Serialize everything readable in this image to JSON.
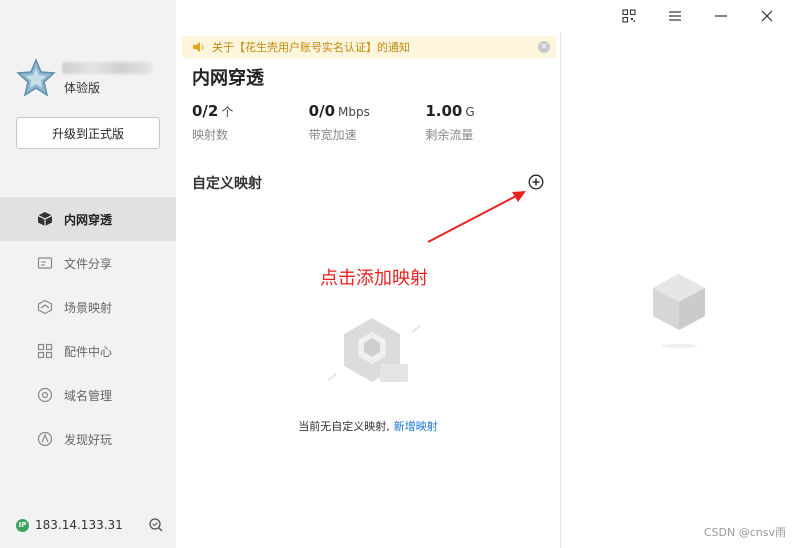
{
  "sidebar": {
    "edition": "体验版",
    "upgrade_label": "升级到正式版",
    "items": [
      {
        "label": "内网穿透",
        "icon": "cube-icon",
        "active": true
      },
      {
        "label": "文件分享",
        "icon": "file-share-icon",
        "active": false
      },
      {
        "label": "场景映射",
        "icon": "scene-map-icon",
        "active": false
      },
      {
        "label": "配件中心",
        "icon": "grid-icon",
        "active": false
      },
      {
        "label": "域名管理",
        "icon": "domain-icon",
        "active": false
      },
      {
        "label": "发现好玩",
        "icon": "discover-icon",
        "active": false
      }
    ],
    "ip": "183.14.133.31",
    "ip_badge": "IP"
  },
  "notice": {
    "text": "关于【花生壳用户账号实名认证】的通知",
    "close": "×"
  },
  "main": {
    "title": "内网穿透",
    "stats": [
      {
        "value": "0/2",
        "unit": "个",
        "label": "映射数"
      },
      {
        "value": "0/0",
        "unit": "Mbps",
        "label": "带宽加速"
      },
      {
        "value": "1.00",
        "unit": "G",
        "label": "剩余流量"
      }
    ],
    "section_title": "自定义映射",
    "annotation": "点击添加映射",
    "empty_text": "当前无自定义映射,",
    "empty_link": "新增映射"
  },
  "watermark": "CSDN @cnsv雨",
  "colors": {
    "accent": "#1677d6",
    "annotation_red": "#e8231f",
    "notice_bg": "#fdf5dc",
    "notice_text": "#c08a10",
    "sidebar_bg": "#f2f2f2",
    "active_item_bg": "#e1e1e1"
  }
}
